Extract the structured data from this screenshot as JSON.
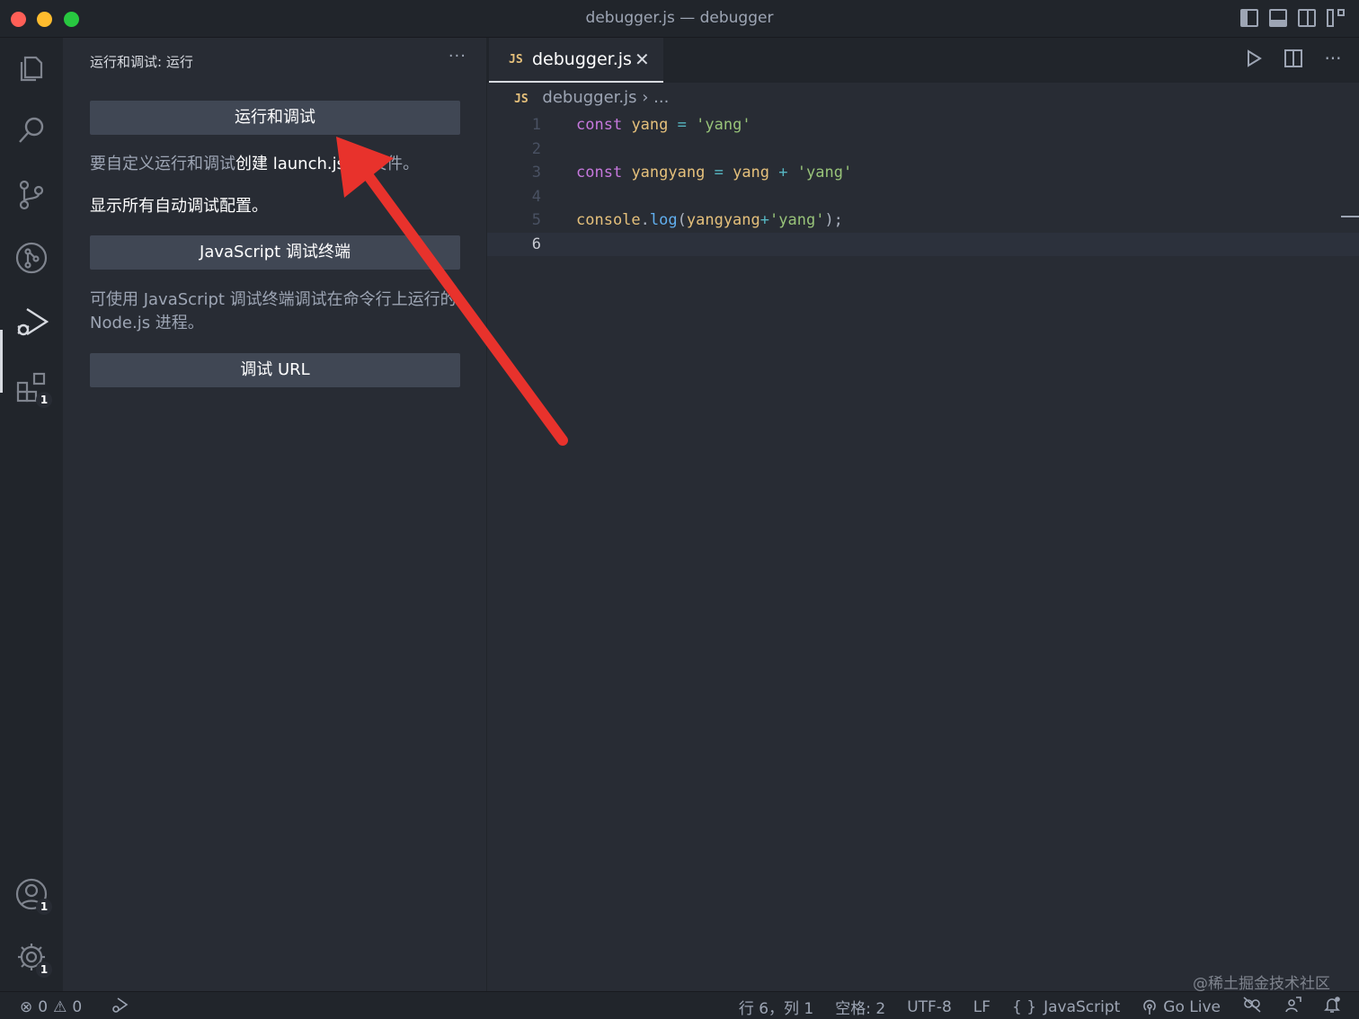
{
  "window": {
    "title": "debugger.js — debugger"
  },
  "activity_bar": {
    "items": [
      {
        "name": "explorer",
        "icon": "files-icon"
      },
      {
        "name": "search",
        "icon": "search-icon"
      },
      {
        "name": "source-control",
        "icon": "source-control-icon"
      },
      {
        "name": "timeline",
        "icon": "git-graph-icon"
      },
      {
        "name": "run-and-debug",
        "icon": "run-debug-icon",
        "active": true
      },
      {
        "name": "extensions",
        "icon": "extensions-icon",
        "badge": "1"
      }
    ],
    "bottom": [
      {
        "name": "accounts",
        "icon": "account-icon",
        "badge": "1"
      },
      {
        "name": "manage",
        "icon": "gear-icon",
        "badge": "1"
      }
    ]
  },
  "sidebar": {
    "title": "运行和调试: 运行",
    "more": "···",
    "run_button": "运行和调试",
    "customize_prefix": "要自定义运行和调试",
    "customize_link_a": "创建 launch",
    "customize_link_b": ".json",
    "customize_suffix": " 文件。",
    "show_all": "显示所有自动调试配置。",
    "js_terminal_button": "JavaScript 调试终端",
    "js_terminal_desc": "可使用 JavaScript 调试终端调试在命令行上运行的 Node.js 进程。",
    "debug_url_button": "调试 URL"
  },
  "editor": {
    "tab": {
      "badge": "JS",
      "label": "debugger.js",
      "close": "✕"
    },
    "breadcrumb": {
      "badge": "JS",
      "file": "debugger.js",
      "sep": "›",
      "rest": "..."
    },
    "lines": [
      {
        "n": "1",
        "tokens": [
          [
            "kw",
            "const"
          ],
          [
            "plain",
            " "
          ],
          [
            "var",
            "yang"
          ],
          [
            "plain",
            " "
          ],
          [
            "op",
            "="
          ],
          [
            "plain",
            " "
          ],
          [
            "str",
            "'yang'"
          ]
        ]
      },
      {
        "n": "2",
        "tokens": []
      },
      {
        "n": "3",
        "tokens": [
          [
            "kw",
            "const"
          ],
          [
            "plain",
            " "
          ],
          [
            "var",
            "yangyang"
          ],
          [
            "plain",
            " "
          ],
          [
            "op",
            "="
          ],
          [
            "plain",
            " "
          ],
          [
            "var",
            "yang"
          ],
          [
            "plain",
            " "
          ],
          [
            "op",
            "+"
          ],
          [
            "plain",
            " "
          ],
          [
            "str",
            "'yang'"
          ]
        ]
      },
      {
        "n": "4",
        "tokens": []
      },
      {
        "n": "5",
        "tokens": [
          [
            "var",
            "console"
          ],
          [
            "plain",
            "."
          ],
          [
            "fn",
            "log"
          ],
          [
            "plain",
            "("
          ],
          [
            "var",
            "yangyang"
          ],
          [
            "op",
            "+"
          ],
          [
            "str",
            "'yang'"
          ],
          [
            "plain",
            ");"
          ]
        ]
      },
      {
        "n": "6",
        "tokens": [],
        "current": true
      }
    ]
  },
  "status_bar": {
    "errors": "0",
    "warnings": "0",
    "position": "行 6，列 1",
    "spaces": "空格: 2",
    "encoding": "UTF-8",
    "eol": "LF",
    "lang_icon": "{ }",
    "language": "JavaScript",
    "go_live": "Go Live"
  },
  "watermark": "@稀土掘金技术社区",
  "colors": {
    "accent_arrow": "#e8322c",
    "keyword": "#c678dd",
    "variable": "#e5c07b",
    "string": "#98c379",
    "function": "#61afef"
  }
}
